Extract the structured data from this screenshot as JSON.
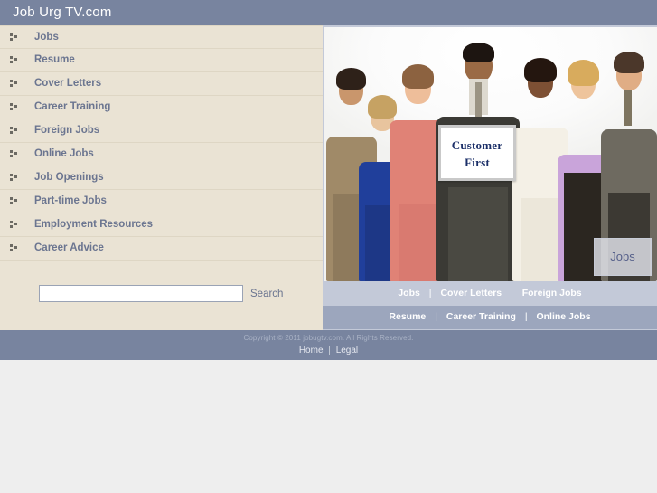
{
  "header": {
    "title": "Job Urg TV.com",
    "bg_color": "#78849f"
  },
  "sidebar": {
    "bg_color": "#eae3d4",
    "bullet_icon": "three-squares-bullet-icon",
    "items": [
      {
        "label": "Jobs"
      },
      {
        "label": "Resume"
      },
      {
        "label": "Cover Letters"
      },
      {
        "label": "Career Training"
      },
      {
        "label": "Foreign Jobs"
      },
      {
        "label": "Online Jobs"
      },
      {
        "label": "Job Openings"
      },
      {
        "label": "Part-time Jobs"
      },
      {
        "label": "Employment Resources"
      },
      {
        "label": "Career Advice"
      }
    ],
    "search": {
      "value": "",
      "placeholder": "",
      "button_label": "Search"
    }
  },
  "hero": {
    "alt": "group of business professionals holding a sign",
    "sign_line_1": "Customer",
    "sign_line_2": "First",
    "badge_label": "Jobs"
  },
  "hero_nav": {
    "row1": [
      "Jobs",
      "Cover Letters",
      "Foreign Jobs"
    ],
    "row2": [
      "Resume",
      "Career Training",
      "Online Jobs"
    ],
    "separator": "|",
    "row1_bg": "#c3c9d8",
    "row2_bg": "#9ca6bd"
  },
  "footer": {
    "copyright": "Copyright © 2011 jobugtv.com. All Rights Reserved.",
    "links": [
      "Home",
      "Legal"
    ],
    "separator": "|",
    "bg_color": "#78849f"
  }
}
